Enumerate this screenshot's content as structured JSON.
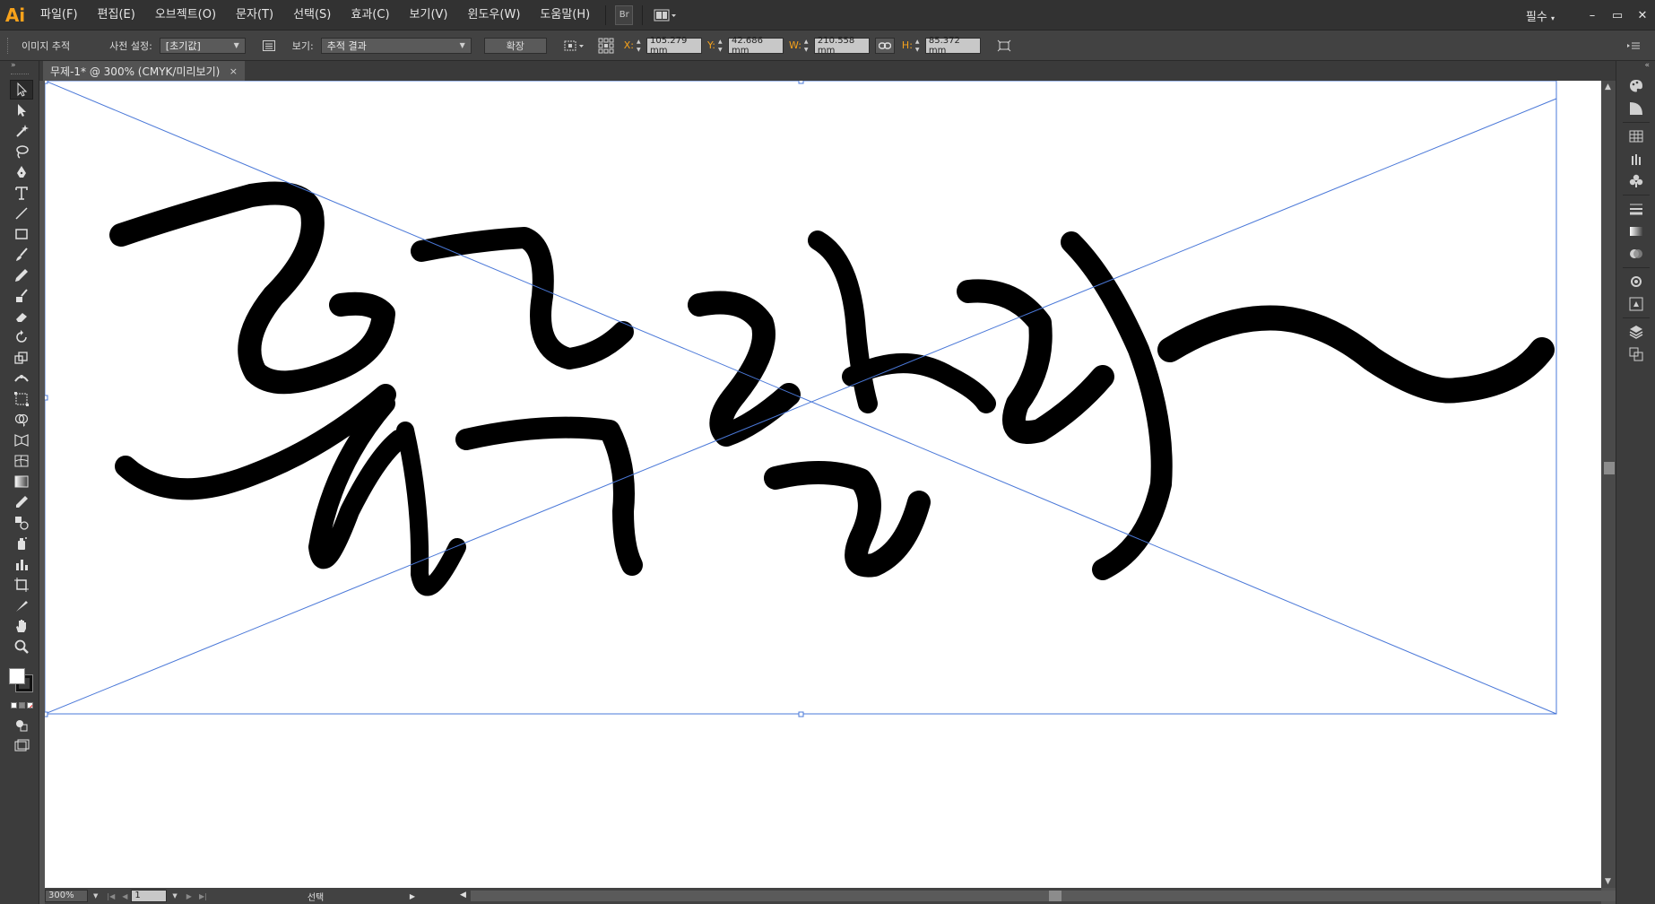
{
  "app": {
    "logo": "Ai"
  },
  "menu": {
    "items": [
      "파일(F)",
      "편집(E)",
      "오브젝트(O)",
      "문자(T)",
      "선택(S)",
      "효과(C)",
      "보기(V)",
      "윈도우(W)",
      "도움말(H)"
    ],
    "bridge": "Br",
    "workspace": "필수",
    "window_controls": [
      "–",
      "▭",
      "✕"
    ]
  },
  "control": {
    "mode": "이미지 추적",
    "preset_label": "사전 설정:",
    "preset_value": "[초기값]",
    "view_label": "보기:",
    "view_value": "추적 결과",
    "expand_button": "확장",
    "x_label": "X:",
    "x_value": "105.279 mm",
    "y_label": "Y:",
    "y_value": "42.686 mm",
    "w_label": "W:",
    "w_value": "210.558 mm",
    "h_label": "H:",
    "h_value": "85.372 mm"
  },
  "document": {
    "tab_title": "무제-1* @ 300% (CMYK/미리보기)",
    "close": "×"
  },
  "status": {
    "zoom": "300%",
    "page": "1",
    "tool": "선택"
  },
  "icons": {
    "tools": [
      "selection-icon",
      "direct-selection-icon",
      "magic-wand-icon",
      "lasso-icon",
      "pen-icon",
      "type-icon",
      "line-icon",
      "rectangle-icon",
      "paintbrush-icon",
      "pencil-icon",
      "blob-brush-icon",
      "eraser-icon",
      "rotate-icon",
      "scale-icon",
      "width-icon",
      "free-transform-icon",
      "shape-builder-icon",
      "perspective-icon",
      "mesh-icon",
      "gradient-icon",
      "eyedropper-icon",
      "blend-icon",
      "symbol-sprayer-icon",
      "graph-icon",
      "artboard-icon",
      "slice-icon",
      "hand-icon",
      "zoom-icon"
    ],
    "dock": [
      "color-icon",
      "color-guide-icon",
      "swatches-icon",
      "brushes-icon",
      "symbols-icon",
      "stroke-icon",
      "gradient-panel-icon",
      "transparency-icon",
      "appearance-icon",
      "graphic-styles-icon",
      "layers-icon",
      "artboards-icon"
    ]
  },
  "colors": {
    "accent": "#f7a21b",
    "selection": "#4a78d8",
    "ink": "#000000"
  }
}
